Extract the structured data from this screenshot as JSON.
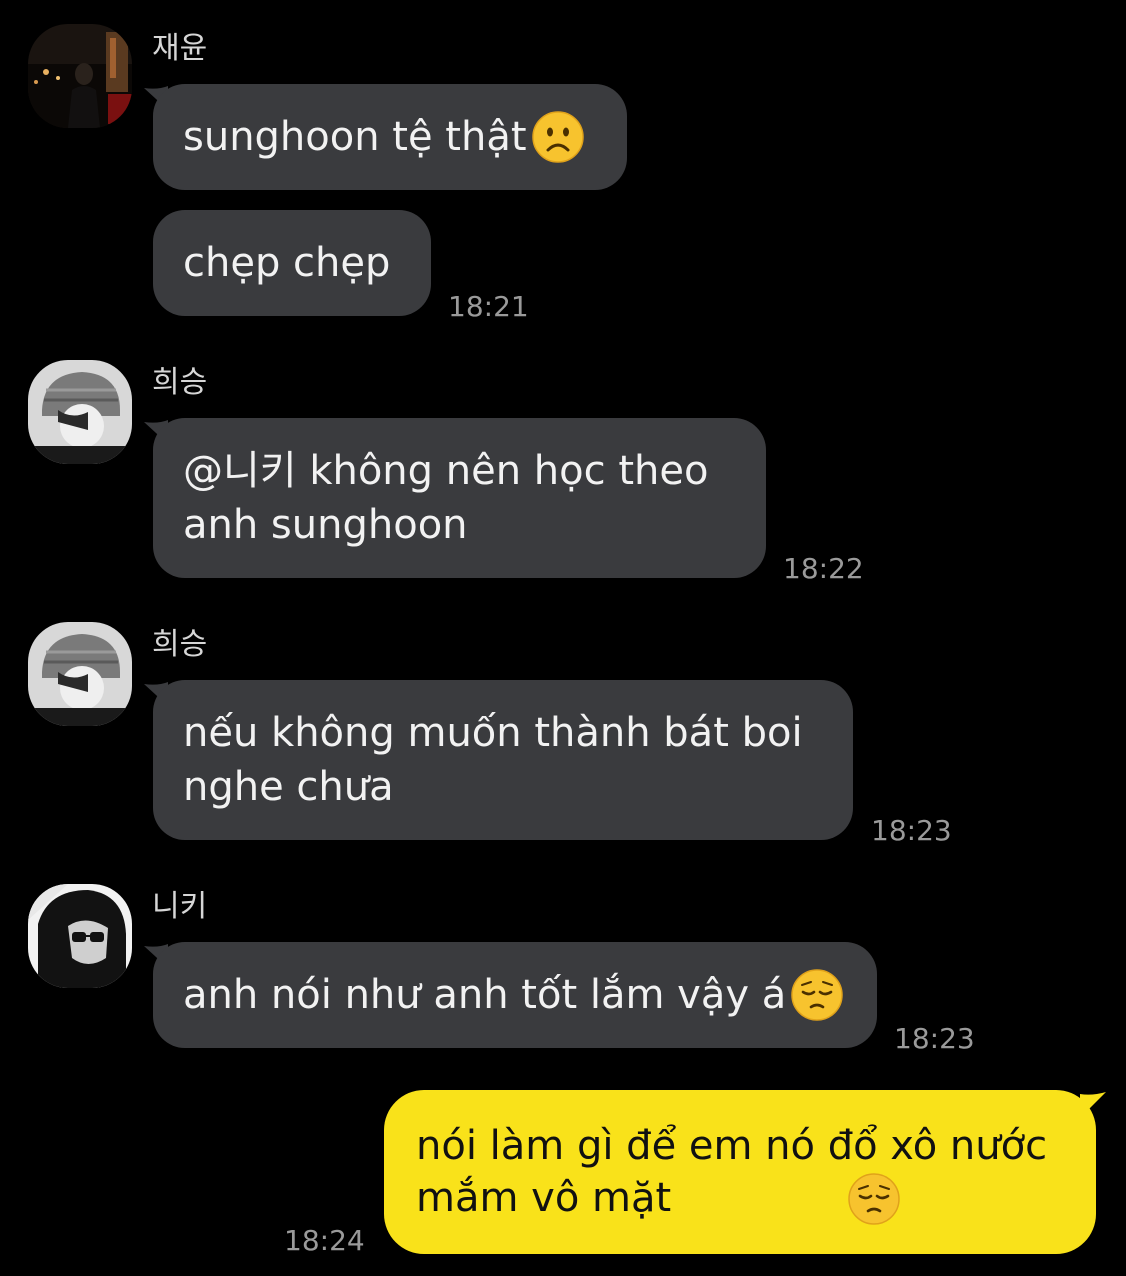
{
  "colors": {
    "background": "#000000",
    "bubble_other": "#3a3b3e",
    "bubble_mine": "#f9e21a",
    "text_other": "#f2f2f2",
    "text_mine": "#111111",
    "timestamp": "#9a9a9a",
    "sender_name": "#d6d6d6"
  },
  "messages": [
    {
      "sender": "재윤",
      "avatar": "profile-photo-night-city",
      "bubbles": [
        {
          "text": "sunghoon tệ thật",
          "emoji": "frowning-face-emoji"
        },
        {
          "text": "chẹp chẹp"
        }
      ],
      "time": "18:21"
    },
    {
      "sender": "희승",
      "avatar": "profile-photo-beanie",
      "bubbles": [
        {
          "text": "@니키 không nên học theo\nanh sunghoon"
        }
      ],
      "time": "18:22"
    },
    {
      "sender": "희승",
      "avatar": "profile-photo-beanie",
      "bubbles": [
        {
          "text": "nếu không muốn thành bát boi\nnghe chưa"
        }
      ],
      "time": "18:23"
    },
    {
      "sender": "니키",
      "avatar": "profile-photo-bw",
      "bubbles": [
        {
          "text": "anh nói như anh tốt lắm vậy á",
          "emoji": "pensive-face-emoji"
        }
      ],
      "time": "18:23"
    }
  ],
  "my_message": {
    "text": "nói làm gì để em nó đổ xô nước\nmắm vô mặt",
    "emoji": "pensive-face-emoji",
    "time": "18:24"
  }
}
